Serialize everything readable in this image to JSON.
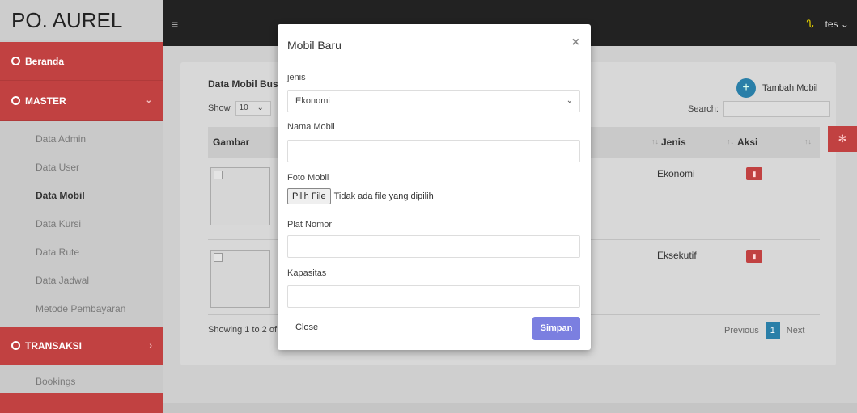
{
  "brand": "PO. AUREL",
  "topbar": {
    "menu_glyph": "≡",
    "user_label": "tes ⌄"
  },
  "sidebar": {
    "beranda": "Beranda",
    "master": "MASTER",
    "master_items": [
      "Data Admin",
      "Data User",
      "Data Mobil",
      "Data Kursi",
      "Data Rute",
      "Data Jadwal",
      "Metode Pembayaran"
    ],
    "transaksi": "TRANSAKSI",
    "transaksi_items": [
      "Bookings"
    ]
  },
  "card": {
    "title": "Data Mobil Bus",
    "show_label": "Show",
    "show_value": "10",
    "add_button": "Tambah Mobil",
    "search_label": "Search:",
    "columns": [
      "Gambar",
      "Jenis",
      "Aksi"
    ],
    "rows": [
      {
        "jenis": "Ekonomi"
      },
      {
        "jenis": "Eksekutif"
      }
    ],
    "showing_text": "Showing 1 to 2 of",
    "pager": {
      "previous": "Previous",
      "current": "1",
      "next": "Next"
    }
  },
  "modal": {
    "title": "Mobil Baru",
    "close_glyph": "×",
    "jenis_label": "jenis",
    "jenis_value": "Ekonomi",
    "nama_label": "Nama Mobil",
    "nama_value": "",
    "foto_label": "Foto Mobil",
    "file_button": "Pilih File",
    "file_status": "Tidak ada file yang dipilih",
    "plat_label": "Plat Nomor",
    "plat_value": "",
    "kapasitas_label": "Kapasitas",
    "kapasitas_value": "",
    "close_text": "Close",
    "save_text": "Simpan"
  },
  "colors": {
    "sidebar_red": "#c14141",
    "topbar": "#222222",
    "save_button": "#7b7fe0",
    "accent_blue": "#2a7fa8"
  },
  "icons": [
    "clock-icon",
    "menu-icon",
    "user-icon",
    "plus-icon",
    "trash-icon",
    "gear-icon",
    "close-icon",
    "chevron-down-icon"
  ]
}
